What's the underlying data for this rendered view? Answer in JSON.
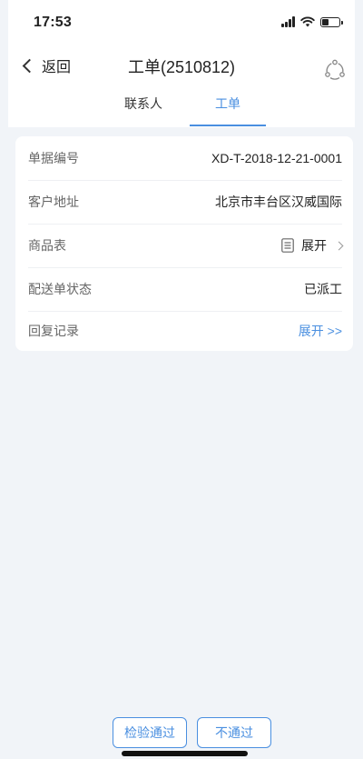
{
  "status_bar": {
    "time": "17:53",
    "signal_icon": "signal-icon",
    "wifi_icon": "wifi-icon",
    "battery_icon": "battery-icon",
    "battery_level": 0.35
  },
  "nav": {
    "back_label": "返回",
    "back_icon": "chevron-left-icon",
    "title": "工单(2510812)",
    "share_icon": "share-icon"
  },
  "tabs": {
    "items": [
      {
        "label": "联系人",
        "active": false
      },
      {
        "label": "工单",
        "active": true
      }
    ],
    "accent_color": "#4a8fe0"
  },
  "details": {
    "rows": [
      {
        "label": "单据编号",
        "value": "XD-T-2018-12-21-0001"
      },
      {
        "label": "客户地址",
        "value": "北京市丰台区汉威国际"
      },
      {
        "label": "商品表",
        "value": "展开",
        "icon": "list-icon",
        "trailing_icon": "chevron-right-icon"
      },
      {
        "label": "配送单状态",
        "value": "已派工"
      },
      {
        "label": "回复记录",
        "value": "展开 >>"
      }
    ]
  },
  "actions": {
    "pass_label": "检验通过",
    "fail_label": "不通过"
  },
  "colors": {
    "accent": "#4a8fe0",
    "background": "#f1f4f8"
  }
}
